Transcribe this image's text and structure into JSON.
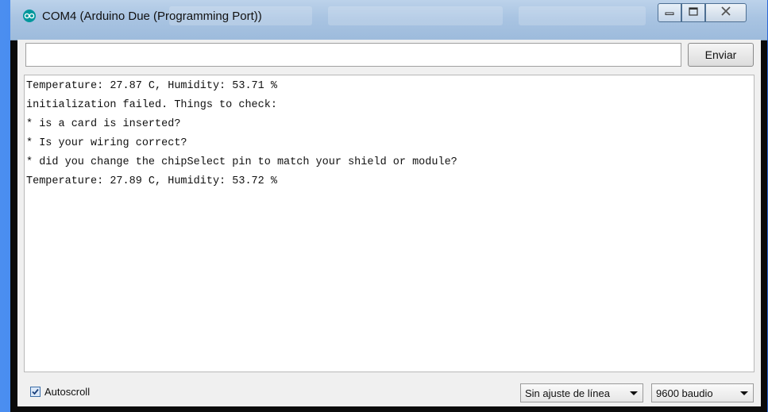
{
  "window": {
    "title": "COM4 (Arduino Due (Programming Port))",
    "logo_icon": "arduino-infinity-icon",
    "controls": [
      "minimize-icon",
      "maximize-icon",
      "close-icon"
    ]
  },
  "send": {
    "input_value": "",
    "button_label": "Enviar"
  },
  "output": {
    "lines": [
      "Temperature: 27.87 C, Humidity: 53.71 %",
      "initialization failed. Things to check:",
      "* is a card is inserted?",
      "* Is your wiring correct?",
      "* did you change the chipSelect pin to match your shield or module?",
      "Temperature: 27.89 C, Humidity: 53.72 %"
    ]
  },
  "footer": {
    "autoscroll_label": "Autoscroll",
    "autoscroll_checked": true,
    "line_ending": "Sin ajuste de línea",
    "baud_rate": "9600 baudio"
  },
  "colors": {
    "desktop": "#3f7fe0",
    "titlebar": "#a9c4e2",
    "accent": "#00979c"
  }
}
